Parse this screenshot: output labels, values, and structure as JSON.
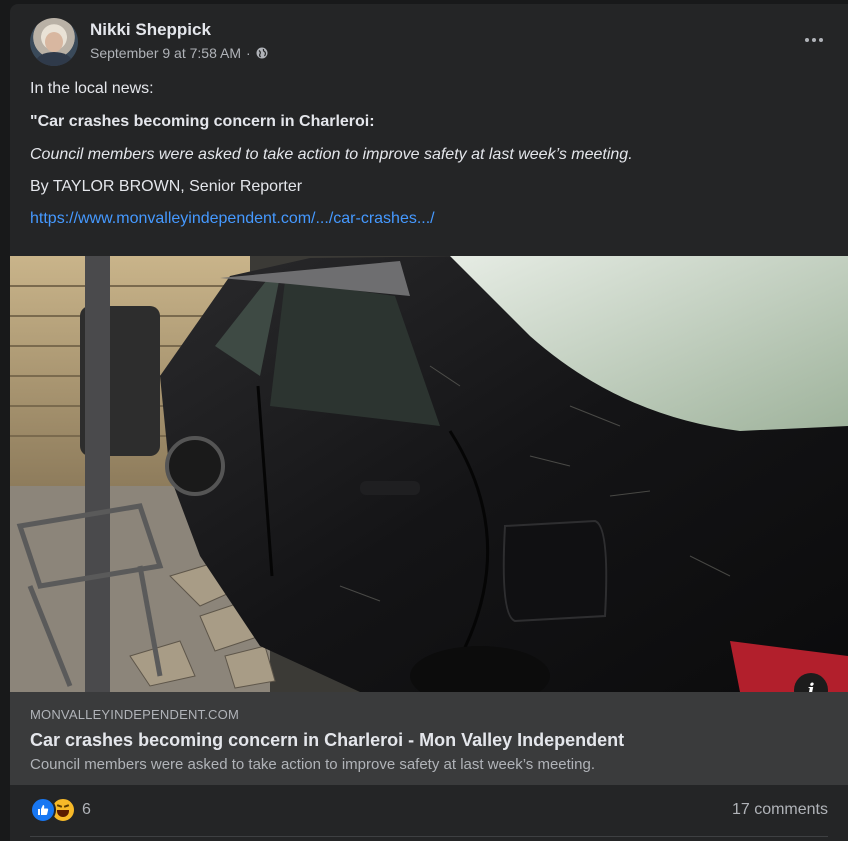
{
  "post": {
    "author": "Nikki Sheppick",
    "timestamp": "September 9 at 7:58 AM",
    "separator": "·",
    "audience_icon": "globe-icon",
    "menu_icon": "more-options-icon",
    "lines": {
      "intro": "In the local news:",
      "headline": "\"Car crashes becoming concern in Charleroi:",
      "summary": "Council members were asked to take action to improve safety at last week’s meeting.",
      "byline": "By TAYLOR BROWN, Senior Reporter",
      "link": "https://www.monvalleyindependent.com/.../car-crashes.../"
    }
  },
  "link_preview": {
    "domain": "MONVALLEYINDEPENDENT.COM",
    "title": "Car crashes becoming concern in Charleroi - Mon Valley Independent",
    "description": "Council members were asked to take action to improve safety at last week’s meeting.",
    "info_icon": "info-icon"
  },
  "footer": {
    "reaction_icons": [
      "like-icon",
      "haha-icon"
    ],
    "reaction_count": "6",
    "comments": "17 comments"
  },
  "colors": {
    "background": "#18191a",
    "card": "#242526",
    "link": "#4599ff",
    "like_blue": "#1877f2"
  }
}
